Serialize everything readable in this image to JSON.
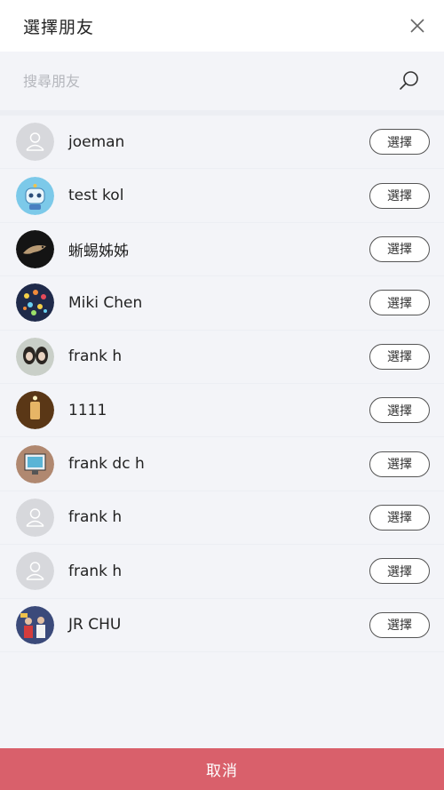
{
  "header": {
    "title": "選擇朋友"
  },
  "search": {
    "placeholder": "搜尋朋友",
    "value": ""
  },
  "select_label": "選擇",
  "friends": [
    {
      "name": "joeman",
      "avatar": "default-avatar-icon"
    },
    {
      "name": "test kol",
      "avatar": "robot-avatar"
    },
    {
      "name": "蜥蜴姊姊",
      "avatar": "lizard-photo-avatar"
    },
    {
      "name": "Miki Chen",
      "avatar": "lights-photo-avatar"
    },
    {
      "name": "frank h",
      "avatar": "people-photo-avatar"
    },
    {
      "name": "1111",
      "avatar": "room-photo-avatar"
    },
    {
      "name": "frank dc h",
      "avatar": "monitor-photo-avatar"
    },
    {
      "name": "frank h",
      "avatar": "default-avatar-icon"
    },
    {
      "name": "frank h",
      "avatar": "default-avatar-icon"
    },
    {
      "name": "JR CHU",
      "avatar": "crowd-photo-avatar"
    }
  ],
  "footer": {
    "cancel_label": "取消"
  },
  "colors": {
    "accent": "#d9606b",
    "background": "#f3f4f8"
  }
}
